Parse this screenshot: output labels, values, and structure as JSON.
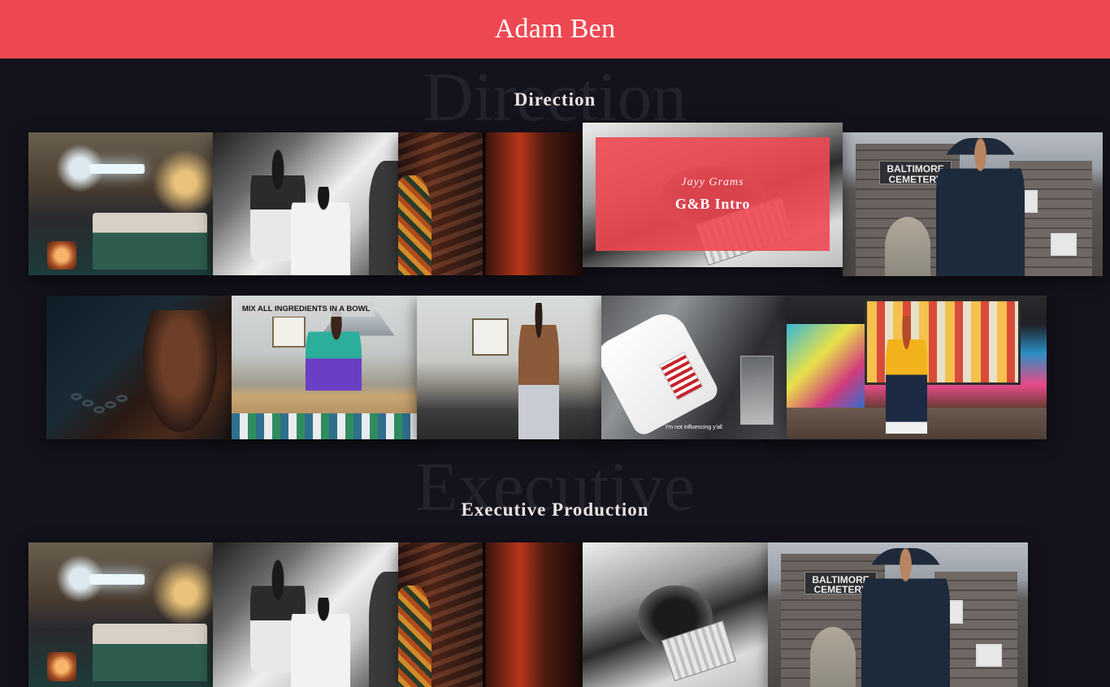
{
  "header": {
    "title": "Adam Ben"
  },
  "sections": {
    "direction": {
      "ghost": "Direction",
      "title": "Direction"
    },
    "executive": {
      "ghost": "Executive",
      "title": "Executive Production"
    }
  },
  "direction_row1": {
    "hover_tile": {
      "artist": "Jayy Grams",
      "title": "G&B Intro"
    },
    "cemetery_sign": "BALTIMORE CEMETERY"
  },
  "direction_row2": {
    "kitchen_caption": "MIX ALL INGREDIENTS IN A BOWL",
    "milk_subtitle": "I'm not influencing y'all"
  },
  "executive_row1": {
    "cemetery_sign": "BALTIMORE CEMETERY"
  },
  "colors": {
    "accent": "#ee4852",
    "background": "#14121c"
  }
}
